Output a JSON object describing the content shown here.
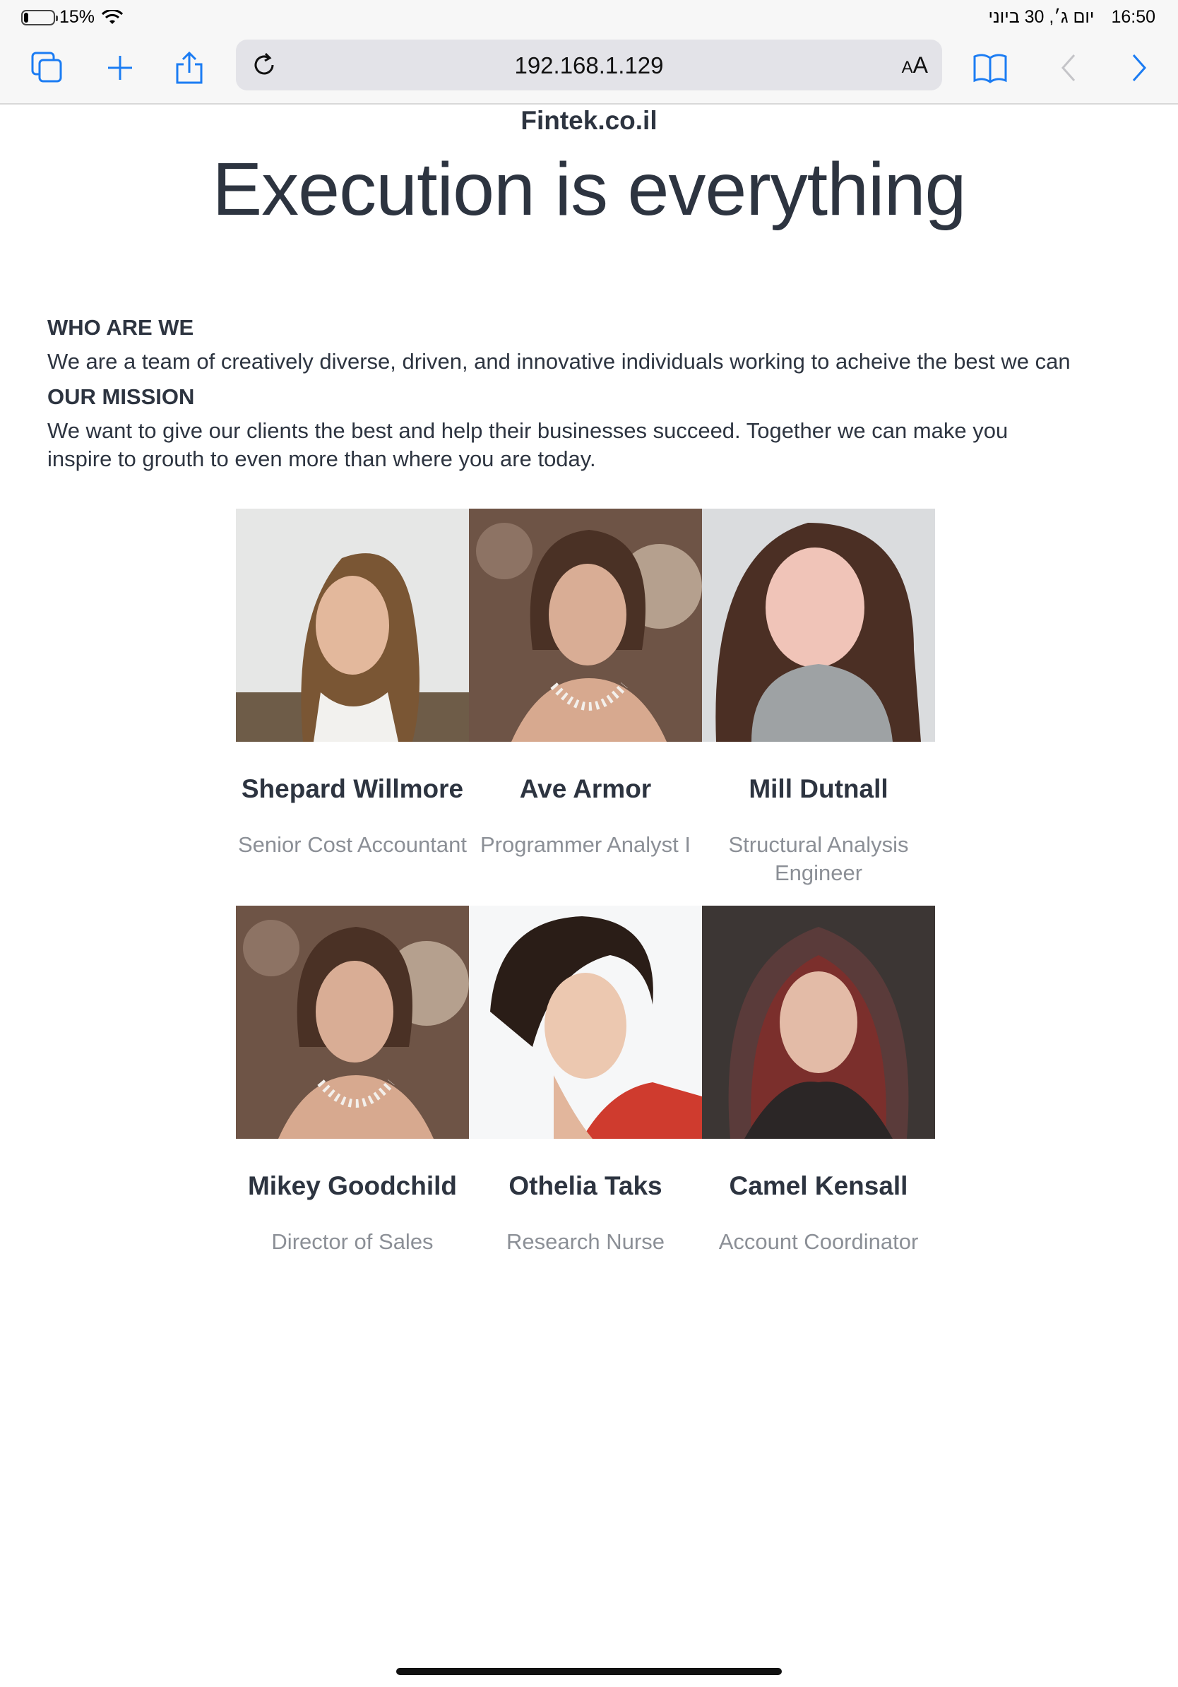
{
  "status": {
    "battery": "15%",
    "battery_level": 0.15,
    "date": "יום ג׳, 30 ביוני",
    "time": "16:50"
  },
  "browser": {
    "url": "192.168.1.129",
    "text_size_label": "AA",
    "icons": [
      "tabs-icon",
      "new-tab-icon",
      "share-icon",
      "reload-icon",
      "bookmarks-icon",
      "back-icon",
      "forward-icon"
    ]
  },
  "page": {
    "brand": "Fintek.co.il",
    "hero": "Execution is everything",
    "who_heading": "WHO ARE WE",
    "who_text": "We are a team of creatively diverse, driven, and innovative individuals working to acheive the best we can",
    "mission_heading": "OUR MISSION",
    "mission_text": "We want to give our clients the best and help their businesses succeed. Together we can make you inspire to grouth to even more than where you are today."
  },
  "team": [
    {
      "name": "Shepard Willmore",
      "role": "Senior Cost Accountant"
    },
    {
      "name": "Ave Armor",
      "role": "Programmer Analyst I"
    },
    {
      "name": "Mill Dutnall",
      "role": "Structural Analysis Engineer"
    },
    {
      "name": "Mikey Goodchild",
      "role": "Director of Sales"
    },
    {
      "name": "Othelia Taks",
      "role": "Research Nurse"
    },
    {
      "name": "Camel Kensall",
      "role": "Account Coordinator"
    }
  ],
  "colors": {
    "accent": "#1b7cf3",
    "text": "#2d3440",
    "muted": "#8b8f96"
  }
}
